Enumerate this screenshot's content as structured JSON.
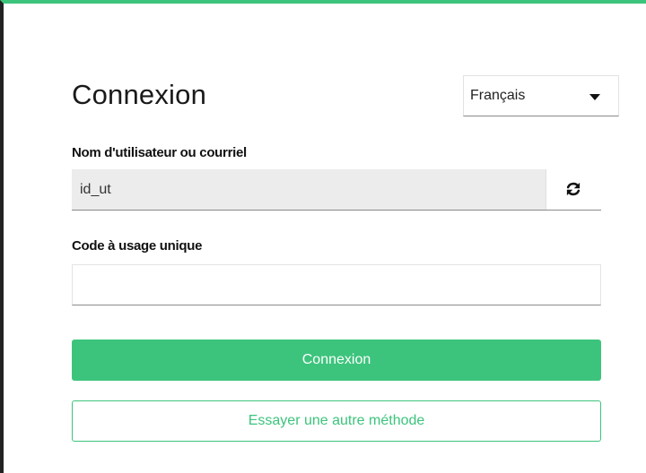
{
  "login": {
    "title": "Connexion",
    "language": {
      "selected": "Français"
    },
    "username": {
      "label": "Nom d'utilisateur ou courriel",
      "value": "id_ut"
    },
    "otp": {
      "label": "Code à usage unique",
      "value": ""
    },
    "submit_label": "Connexion",
    "alt_method_label": "Essayer une autre méthode"
  },
  "colors": {
    "accent": "#3cc47c",
    "field_bg": "#ececec",
    "border_top": "#3cc47c"
  },
  "icons": {
    "refresh": "refresh-icon",
    "dropdown": "chevron-down-icon"
  }
}
